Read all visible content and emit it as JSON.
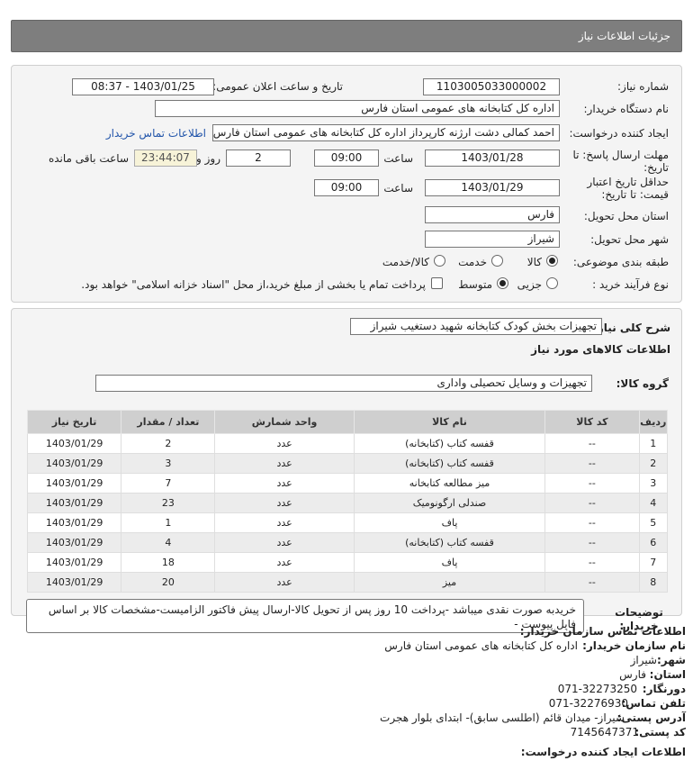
{
  "page": {
    "title": "جزئیات اطلاعات نیاز"
  },
  "need": {
    "number_label": "شماره نیاز:",
    "number": "1103005033000002",
    "announce_label": "تاریخ و ساعت اعلان عمومی:",
    "announce": "1403/01/25 - 08:37",
    "buyer_label": "نام دستگاه خریدار:",
    "buyer": "اداره کل کتابخانه های عمومی استان فارس",
    "creator_label": "ایجاد کننده درخواست:",
    "creator": "احمد  کمالی دشت ارژنه   کارپرداز اداره کل کتابخانه های عمومی استان فارس",
    "contact_link": "اطلاعات تماس خریدار",
    "deadline_label": "مهلت ارسال پاسخ: تا تاریخ:",
    "deadline_date": "1403/01/28",
    "time_label": "ساعت",
    "deadline_time": "09:00",
    "days": "2",
    "days_label": "روز و",
    "remaining": "23:44:07",
    "remaining_label": "ساعت باقی مانده",
    "validity_label": "حداقل تاریخ اعتبار قیمت: تا تاریخ:",
    "validity_date": "1403/01/29",
    "validity_time": "09:00",
    "province_label": "استان محل تحویل:",
    "province": "فارس",
    "city_label": "شهر محل تحویل:",
    "city": "شیراز",
    "category_label": "طبقه بندی موضوعی:",
    "category_options": [
      "کالا",
      "خدمت",
      "کالا/خدمت"
    ],
    "process_label": "نوع فرآیند خرید :",
    "process_options": [
      "جزیی",
      "متوسط"
    ],
    "payment_note": "پرداخت تمام یا بخشی از مبلغ خرید،از محل \"اسناد خزانه اسلامی\" خواهد بود."
  },
  "summary": {
    "desc_label": "شرح کلی نیاز:",
    "desc": "تجهیزات بخش کودک کتابخانه شهید دستغیب شیراز",
    "items_heading": "اطلاعات کالاهای مورد نیاز",
    "group_label": "گروه کالا:",
    "group": "تجهیزات و وسایل تحصیلی واداری"
  },
  "table": {
    "headers": [
      "ردیف",
      "کد کالا",
      "نام کالا",
      "واحد شمارش",
      "تعداد / مقدار",
      "تاریخ نیاز"
    ],
    "rows": [
      [
        "1",
        "--",
        "قفسه کتاب (کتابخانه)",
        "عدد",
        "2",
        "1403/01/29"
      ],
      [
        "2",
        "--",
        "قفسه کتاب (کتابخانه)",
        "عدد",
        "3",
        "1403/01/29"
      ],
      [
        "3",
        "--",
        "میز مطالعه کتابخانه",
        "عدد",
        "7",
        "1403/01/29"
      ],
      [
        "4",
        "--",
        "صندلی ارگونومیک",
        "عدد",
        "23",
        "1403/01/29"
      ],
      [
        "5",
        "--",
        "پاف",
        "عدد",
        "1",
        "1403/01/29"
      ],
      [
        "6",
        "--",
        "قفسه کتاب (کتابخانه)",
        "عدد",
        "4",
        "1403/01/29"
      ],
      [
        "7",
        "--",
        "پاف",
        "عدد",
        "18",
        "1403/01/29"
      ],
      [
        "8",
        "--",
        "میز",
        "عدد",
        "20",
        "1403/01/29"
      ]
    ]
  },
  "notes": {
    "label": "توضیحات خریدار:",
    "text": "خریدبه صورت نقدی میباشد -پرداخت 10 روز پس از تحویل کالا-ارسال پیش فاکتور الزامیست-مشخصات کالا بر اساس فایل پیوست -"
  },
  "contact": {
    "heading": "اطلاعات تماس سازمان خریدار:",
    "org_label": "نام سازمان خریدار:",
    "org": "اداره کل کتابخانه های عمومی استان فارس",
    "city_label": "شهر:",
    "city": "شیراز",
    "province_label": "استان:",
    "province": "فارس",
    "fax_label": "دورنگار:",
    "fax": "071-32273250",
    "phone_label": "تلفن تماس:",
    "phone": "071-32276930",
    "address_label": "آدرس پستی:",
    "address": "شیراز- میدان قائم (اطلسی سابق)- ابتدای بلوار هجرت",
    "postal_label": "کد پستی:",
    "postal": "7145647371",
    "creator_info_label": "اطلاعات ایجاد کننده درخواست:"
  }
}
